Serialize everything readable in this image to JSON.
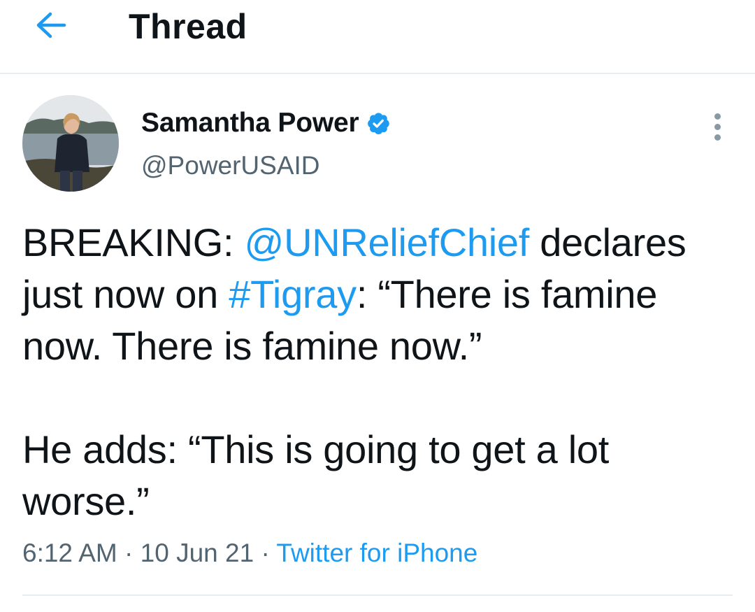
{
  "header": {
    "back_icon": "arrow-left-icon",
    "title": "Thread"
  },
  "colors": {
    "accent": "#1d9bf0",
    "text": "#0f1419",
    "secondary_text": "#536471",
    "divider": "#e6ecf0"
  },
  "tweet": {
    "author": {
      "name": "Samantha Power",
      "handle": "@PowerUSAID",
      "verified_icon": "verified-badge-icon",
      "avatar": "avatar"
    },
    "more_icon": "more-vertical-icon",
    "body": {
      "line1_prefix": "BREAKING: ",
      "mention": "@UNReliefChief",
      "line1_after_mention": " declares just now on ",
      "hashtag": "#Tigray",
      "line1_after_hashtag": ": “There is famine now. There is famine now.”",
      "paragraph2": "He adds: “This is going to get a lot worse.”"
    },
    "time": "6:12 AM",
    "sep1": " · ",
    "date": "10 Jun 21",
    "sep2": " · ",
    "source": "Twitter for iPhone"
  }
}
